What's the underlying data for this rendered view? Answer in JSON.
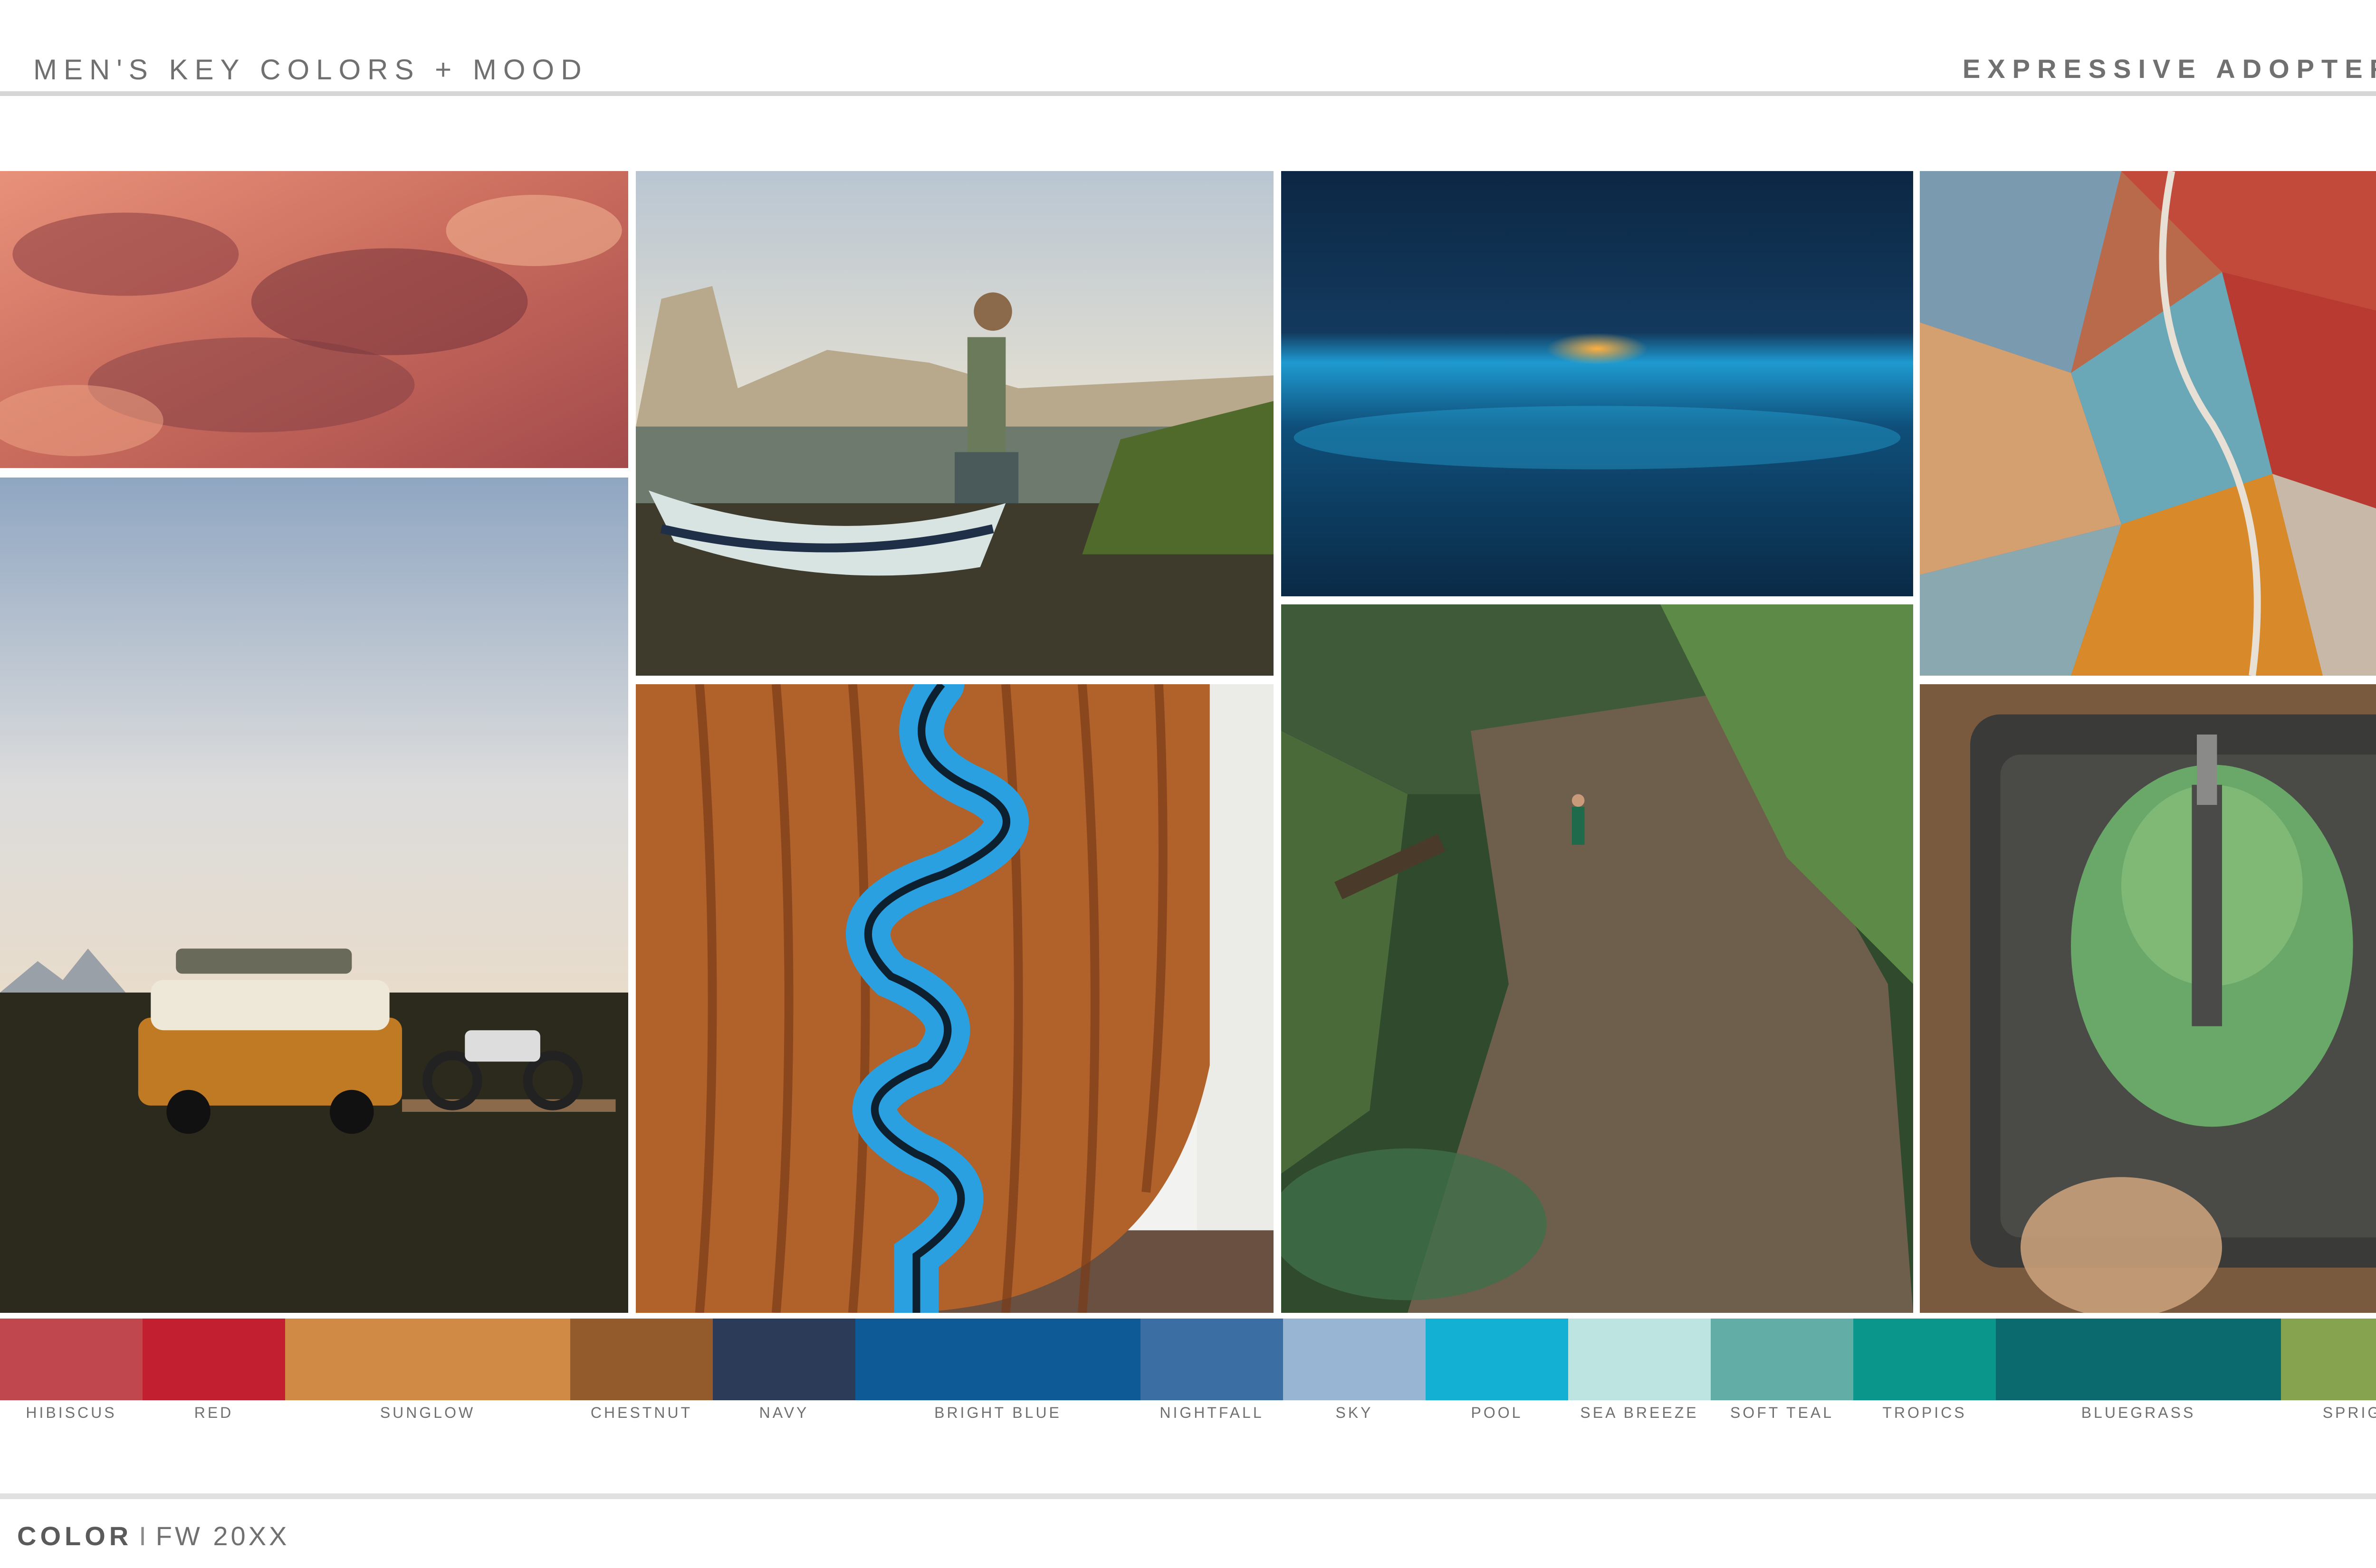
{
  "header": {
    "title": "MEN'S KEY COLORS + MOOD",
    "segment": "EXPRESSIVE ADOPTER"
  },
  "photos": [
    {
      "name": "sunset-clouds-photo",
      "palette": [
        "#c8665a",
        "#e89a7e",
        "#7a3a3e"
      ]
    },
    {
      "name": "van-motorcycle-photo",
      "palette": [
        "#a8b7c9",
        "#2c2a1c",
        "#c57a2a"
      ]
    },
    {
      "name": "drift-boat-river-photo",
      "palette": [
        "#c9d1d6",
        "#4b4a36",
        "#7a8a7a"
      ]
    },
    {
      "name": "wooden-paddle-river-art-photo",
      "palette": [
        "#b0652a",
        "#2a9ad8",
        "#7a3a18"
      ]
    },
    {
      "name": "bioluminescent-ocean-photo",
      "palette": [
        "#0d2a4a",
        "#0a6e9e",
        "#e87a20"
      ]
    },
    {
      "name": "forest-trail-runner-photo",
      "palette": [
        "#2a4a2a",
        "#7a6a58",
        "#5a8a4a"
      ]
    },
    {
      "name": "rainbow-mountains-aerial-photo",
      "palette": [
        "#c85a3a",
        "#6aa8b8",
        "#d88a3a"
      ]
    },
    {
      "name": "cactus-knife-photo",
      "palette": [
        "#8a6a4a",
        "#6aa86a",
        "#3a3a3a"
      ]
    }
  ],
  "swatches": [
    {
      "label": "HIBISCUS",
      "color": "#c0474d",
      "span": 1
    },
    {
      "label": "RED",
      "color": "#c21f30",
      "span": 1
    },
    {
      "label": "SUNGLOW",
      "color": "#d08a46",
      "span": 2
    },
    {
      "label": "CHESTNUT",
      "color": "#935a2b",
      "span": 1
    },
    {
      "label": "NAVY",
      "color": "#2c3b58",
      "span": 1
    },
    {
      "label": "BRIGHT BLUE",
      "color": "#0e5a96",
      "span": 2
    },
    {
      "label": "NIGHTFALL",
      "color": "#3b6ea3",
      "span": 1
    },
    {
      "label": "SKY",
      "color": "#98b6d4",
      "span": 1
    },
    {
      "label": "POOL",
      "color": "#13b0d3",
      "span": 1
    },
    {
      "label": "SEA BREEZE",
      "color": "#bde4e0",
      "span": 1
    },
    {
      "label": "SOFT TEAL",
      "color": "#62ada6",
      "span": 1
    },
    {
      "label": "TROPICS",
      "color": "#0a968a",
      "span": 1
    },
    {
      "label": "BLUEGRASS",
      "color": "#0b6a6e",
      "span": 2
    },
    {
      "label": "SPRIG",
      "color": "#86a450",
      "span": 1
    }
  ],
  "footer": {
    "section": "COLOR",
    "separator": "I",
    "season": "FW 20XX"
  }
}
